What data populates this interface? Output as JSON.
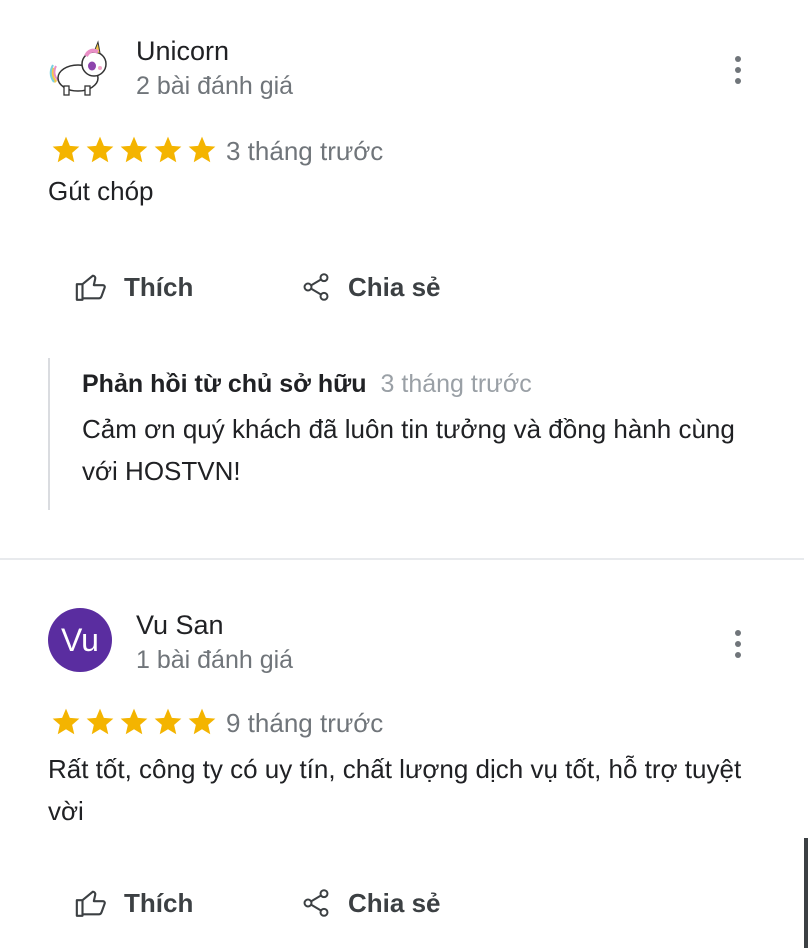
{
  "reviews": [
    {
      "reviewer_name": "Unicorn",
      "review_count": "2 bài đánh giá",
      "avatar_icon": "unicorn-icon",
      "rating": 5,
      "time": "3 tháng trước",
      "text": "Gút chóp",
      "like_label": "Thích",
      "share_label": "Chia sẻ",
      "owner_reply": {
        "title": "Phản hồi từ chủ sở hữu",
        "time": "3 tháng trước",
        "text": "Cảm ơn quý khách đã luôn tin tưởng và đồng hành cùng với HOSTVN!"
      }
    },
    {
      "reviewer_name": "Vu San",
      "review_count": "1 bài đánh giá",
      "avatar_letter": "Vu",
      "avatar_color": "#5a2da0",
      "rating": 5,
      "time": "9 tháng trước",
      "text": "Rất tốt, công ty có uy tín, chất lượng dịch vụ tốt, hỗ trợ tuyệt vời",
      "like_label": "Thích",
      "share_label": "Chia sẻ"
    }
  ],
  "colors": {
    "star": "#f4b400",
    "secondary_text": "#70757a",
    "avatar_purple": "#5a2da0"
  }
}
